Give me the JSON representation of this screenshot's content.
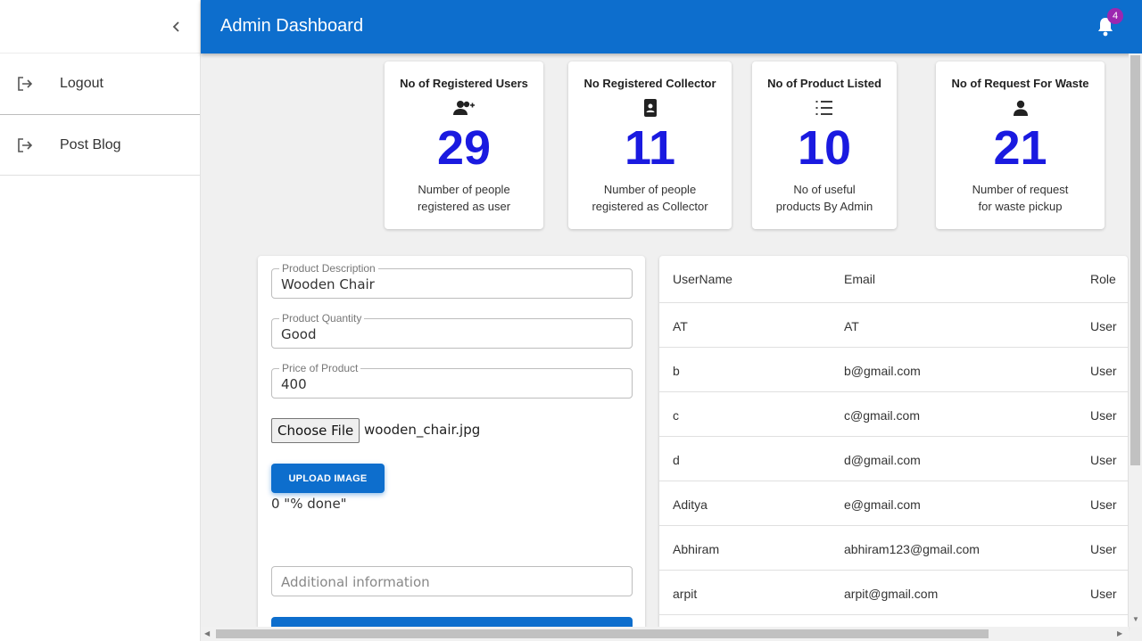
{
  "sidebar": {
    "items": [
      {
        "label": "Logout",
        "icon": "logout-icon"
      },
      {
        "label": "Post Blog",
        "icon": "logout-icon"
      }
    ]
  },
  "header": {
    "title": "Admin Dashboard",
    "notification_count": "4"
  },
  "stats": [
    {
      "title": "No of Registered Users",
      "icon": "group-add-icon",
      "value": "29",
      "desc_line1": "Number of people",
      "desc_line2": "registered as user"
    },
    {
      "title": "No Registered Collector",
      "icon": "contact-phone-icon",
      "value": "11",
      "desc_line1": "Number of people",
      "desc_line2": "registered as Collector"
    },
    {
      "title": "No of Product Listed",
      "icon": "list-icon",
      "value": "10",
      "desc_line1": "No of useful",
      "desc_line2": "products By Admin"
    },
    {
      "title": "No of Request For Waste",
      "icon": "person-icon",
      "value": "21",
      "desc_line1": "Number of request",
      "desc_line2": "for waste pickup"
    }
  ],
  "form": {
    "description": {
      "label": "Product Description",
      "value": "Wooden Chair"
    },
    "quantity": {
      "label": "Product Quantity",
      "value": "Good"
    },
    "price": {
      "label": "Price of Product",
      "value": "400"
    },
    "choose_file_label": "Choose File",
    "file_name": "wooden_chair.jpg",
    "upload_label": "UPLOAD IMAGE",
    "progress_text": "0 \"% done\"",
    "additional_placeholder": "Additional information"
  },
  "users_table": {
    "headers": [
      "UserName",
      "Email",
      "Role"
    ],
    "rows": [
      [
        "AT",
        "AT",
        "User"
      ],
      [
        "b",
        "b@gmail.com",
        "User"
      ],
      [
        "c",
        "c@gmail.com",
        "User"
      ],
      [
        "d",
        "d@gmail.com",
        "User"
      ],
      [
        "Aditya",
        "e@gmail.com",
        "User"
      ],
      [
        "Abhiram",
        "abhiram123@gmail.com",
        "User"
      ],
      [
        "arpit",
        "arpit@gmail.com",
        "User"
      ]
    ]
  },
  "colors": {
    "primary": "#0d6ecd",
    "stat_number": "#1a1ae0",
    "badge": "#9c27b0"
  }
}
